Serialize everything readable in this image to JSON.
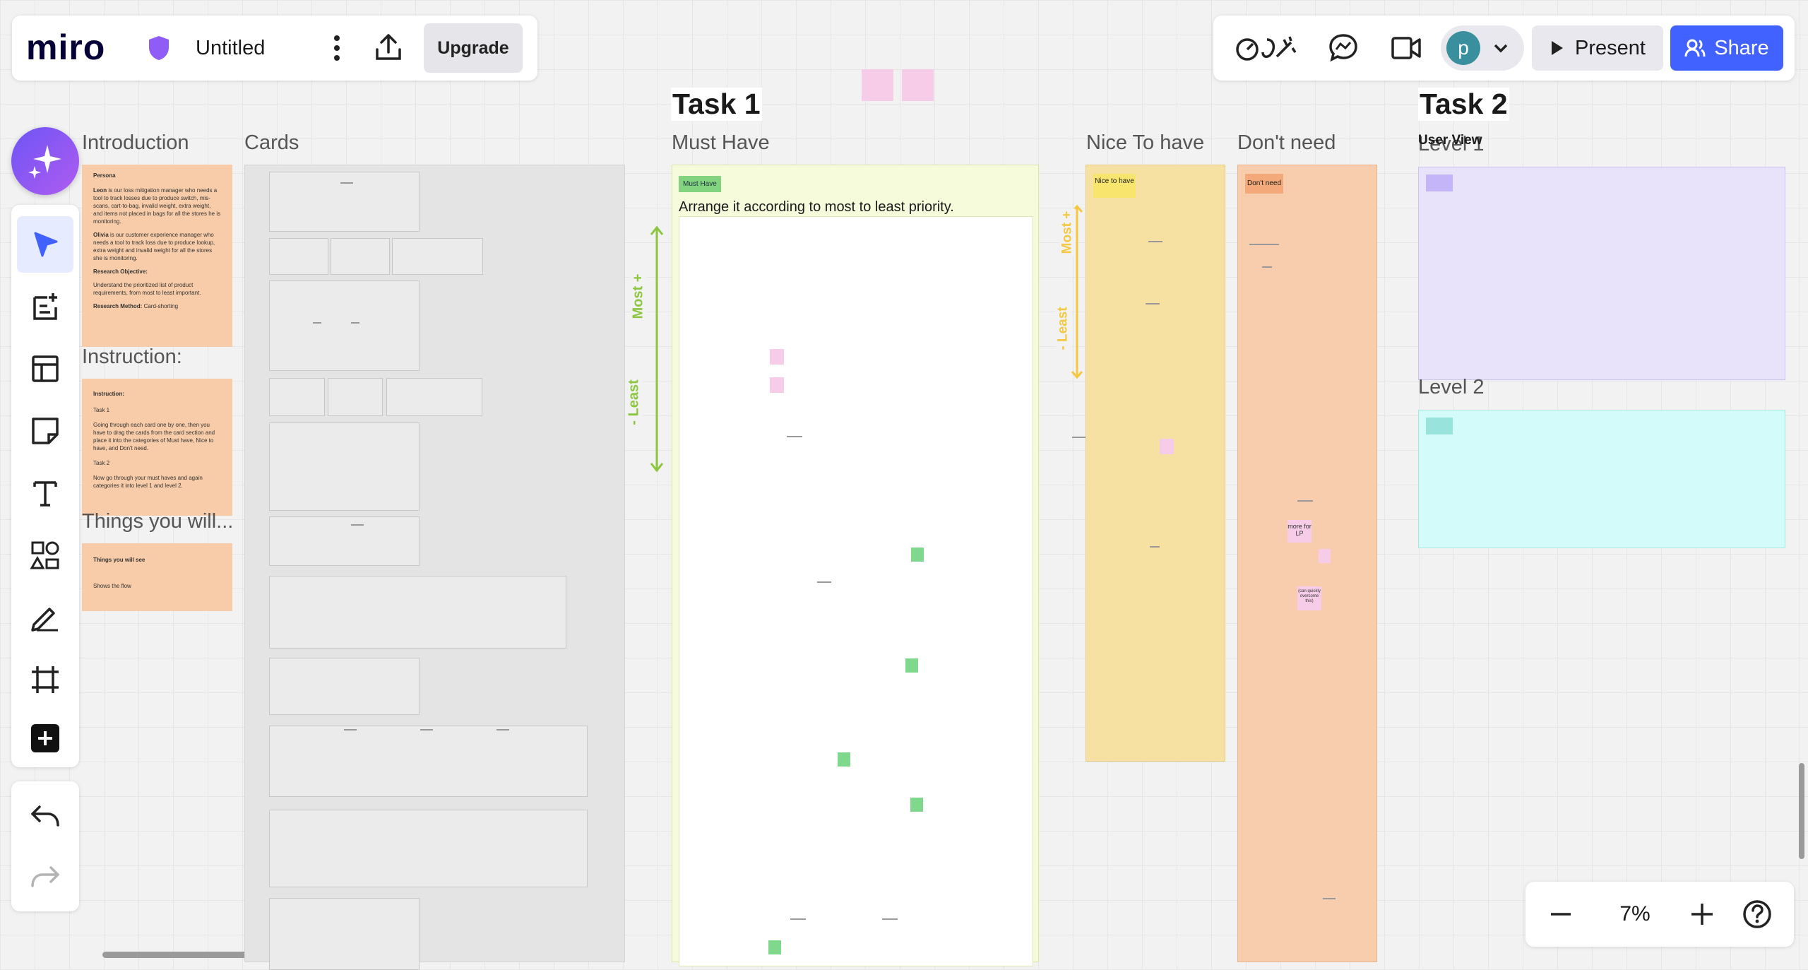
{
  "topbar": {
    "logo": "miro",
    "board_title": "Untitled",
    "upgrade_label": "Upgrade"
  },
  "top_right": {
    "avatar_letter": "p",
    "present_label": "Present",
    "share_label": "Share"
  },
  "zoom": {
    "level": "7%"
  },
  "colors": {
    "accent": "#4262ff",
    "ai_purple": "#8f5cf5",
    "avatar": "#3a8f9e"
  },
  "toolbar_icons": [
    "sparkle-icon",
    "select-arrow-icon",
    "templates-icon",
    "table-layout-icon",
    "sticky-note-icon",
    "text-icon",
    "shapes-icon",
    "pen-icon",
    "frame-icon",
    "plus-icon",
    "undo-icon",
    "redo-icon"
  ],
  "board": {
    "introduction": {
      "title": "Introduction",
      "heading": "Persona",
      "leon_name": "Leon",
      "leon_text": " is our loss mitigation manager who needs a tool to track losses due to produce switch, mis-scans, cart-to-bag, invalid weight, extra weight, and items not placed in bags for all the stores he is monitoring.",
      "olivia_name": "Olivia",
      "olivia_text": " is our customer experience manager who needs a tool to track loss due to produce lookup, extra weight and invalid weight for all the stores she is monitoring.",
      "objective_label": "Research Objective:",
      "objective_text": "Understand the prioritized list of product requirements, from most to least important.",
      "method_label": "Research Method:",
      "method_text": " Card-shorting"
    },
    "instruction": {
      "title": "Instruction:",
      "heading": "Instruction:",
      "task1": "Task 1",
      "task1_text": "Going through each card one by one, then you have to  drag the cards from the card section and place it into the categories of Must have, Nice to have, and Don't need.",
      "task2": "Task 2",
      "task2_text": "Now go through your must haves and again categories it into level 1 and level 2."
    },
    "things": {
      "title": "Things you will...",
      "heading": "Things you will see",
      "text": "Shows the flow"
    },
    "cards_title": "Cards",
    "task1": {
      "title": "Task 1",
      "must_have": {
        "title": "Must Have",
        "tag": "Must Have",
        "instruction": "Arrange it according to most to least priority."
      },
      "axis_most": "Most +",
      "axis_least": "- Least",
      "nice_to_have": {
        "title": "Nice To have",
        "tag": "Nice to have"
      },
      "dont_need": {
        "title": "Don't need",
        "tag": "Don't need",
        "note1": "more for LP",
        "note2": "(can quickly overcome this)"
      }
    },
    "task2": {
      "title": "Task 2",
      "subtitle": "User View",
      "level1": "Level 1",
      "level2": "Level 2"
    }
  }
}
